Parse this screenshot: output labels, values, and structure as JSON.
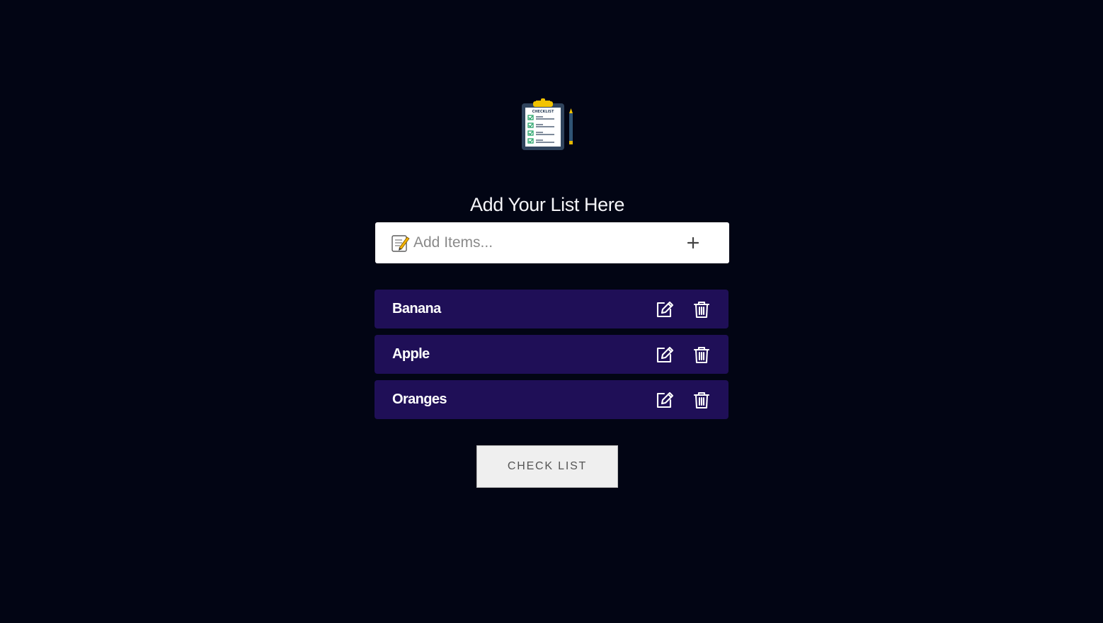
{
  "header": {
    "title": "Add Your List Here",
    "logo": {
      "icon": "checklist-clipboard-icon",
      "text": "CHECKLIST"
    }
  },
  "input": {
    "placeholder": "Add Items...",
    "value": "",
    "icon": "memo-icon",
    "add_icon": "plus-icon"
  },
  "items": [
    {
      "text": "Banana",
      "edit_icon": "edit-icon",
      "delete_icon": "trash-icon"
    },
    {
      "text": "Apple",
      "edit_icon": "edit-icon",
      "delete_icon": "trash-icon"
    },
    {
      "text": "Oranges",
      "edit_icon": "edit-icon",
      "delete_icon": "trash-icon"
    }
  ],
  "actions": {
    "check_list_label": "CHECK LIST"
  },
  "colors": {
    "background": "#020514",
    "item_background": "#1f0f57",
    "input_background": "#ffffff",
    "button_background": "#efefef"
  }
}
